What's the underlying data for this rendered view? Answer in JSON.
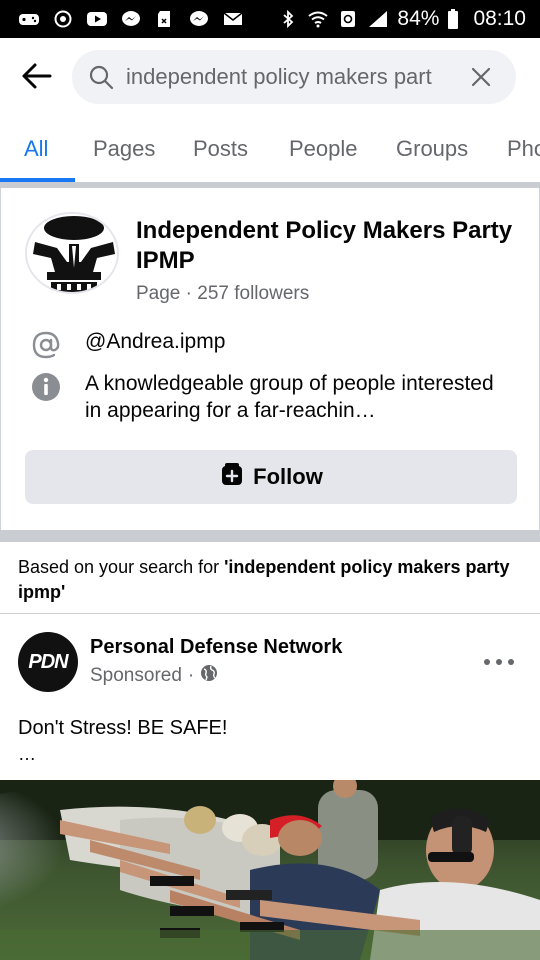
{
  "status_bar": {
    "battery": "84%",
    "time": "08:10"
  },
  "search": {
    "query": "independent policy makers part",
    "back_icon": "back-arrow-icon",
    "search_icon": "search-icon",
    "clear_icon": "close-icon"
  },
  "tabs": [
    "All",
    "Pages",
    "Posts",
    "People",
    "Groups",
    "Pho"
  ],
  "page_result": {
    "name": "Independent Policy Makers Party IPMP",
    "meta": "Page · 257 followers",
    "username": "@Andrea.ipmp",
    "description": "A knowledgeable group of people interested in appearing for a far-reachin…",
    "follow_label": "Follow"
  },
  "based_on": {
    "prefix": "Based on your search for ",
    "query": "'independent policy makers party ipmp'"
  },
  "sponsored_post": {
    "avatar_text": "PDN",
    "author": "Personal Defense Network",
    "sponsored_label": "Sponsored",
    "separator": "·",
    "text": "Don't Stress!  BE SAFE!",
    "ellipsis": "…"
  },
  "colors": {
    "accent": "#1877f2",
    "secondary_text": "#65676b",
    "button_bg": "#e4e6eb"
  }
}
